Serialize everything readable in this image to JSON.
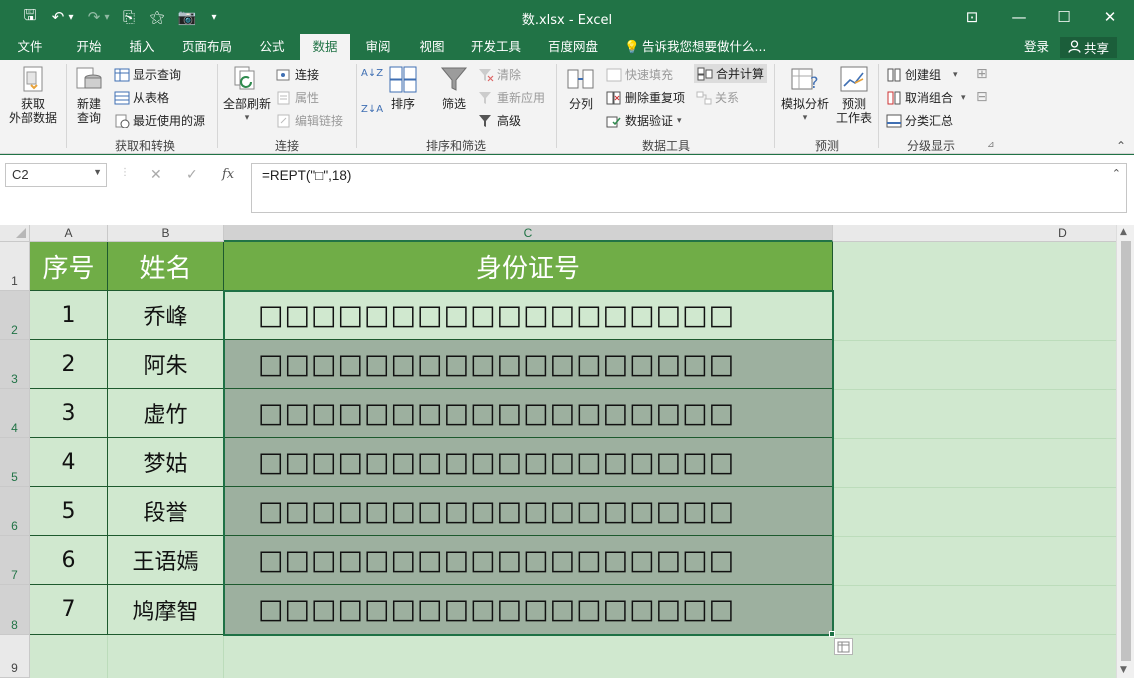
{
  "titlebar": {
    "title": "数.xlsx - Excel",
    "quick_access": {
      "save": "🖫",
      "undo": "↶",
      "undo_dd": "▾",
      "redo": "↷",
      "redo_dd": "▾",
      "q1": "⎘",
      "q2": "⚝",
      "q3": "📷",
      "customize": "▾"
    },
    "window": {
      "ribbon_opts": "⊡",
      "minimize": "—",
      "maximize": "☐",
      "close": "✕"
    }
  },
  "tabs": [
    "文件",
    "开始",
    "插入",
    "页面布局",
    "公式",
    "数据",
    "审阅",
    "视图",
    "开发工具",
    "百度网盘"
  ],
  "active_tab": "数据",
  "tellme": "告诉我您想要做什么...",
  "signin": "登录",
  "share": "共享",
  "ribbon": {
    "get_external": "获取\n外部数据",
    "new_query": "新建\n查询",
    "show_queries": "显示查询",
    "from_table": "从表格",
    "recent_sources": "最近使用的源",
    "group_get_transform": "获取和转换",
    "refresh_all": "全部刷新",
    "connections": "连接",
    "properties": "属性",
    "edit_links": "编辑链接",
    "group_connections": "连接",
    "sort_az": "A↓Z",
    "sort_za": "Z↓A",
    "sort": "排序",
    "filter": "筛选",
    "clear": "清除",
    "reapply": "重新应用",
    "advanced": "高级",
    "group_sort_filter": "排序和筛选",
    "text_to_columns": "分列",
    "flash_fill": "快速填充",
    "remove_duplicates": "删除重复项",
    "data_validation": "数据验证",
    "consolidate": "合并计算",
    "relationships": "关系",
    "group_data_tools": "数据工具",
    "what_if": "模拟分析",
    "forecast_sheet": "预测\n工作表",
    "group_forecast": "预测",
    "group": "创建组",
    "ungroup": "取消组合",
    "subtotal": "分类汇总",
    "group_outline": "分级显示",
    "collapse": "⌃",
    "dropdown": "▾"
  },
  "formula_bar": {
    "name_box": "C2",
    "cancel": "✕",
    "enter": "✓",
    "fx": "fx",
    "formula": "=REPT(\"□\",18)"
  },
  "columns": [
    "A",
    "B",
    "C",
    "D"
  ],
  "rows": [
    "1",
    "2",
    "3",
    "4",
    "5",
    "6",
    "7",
    "8",
    "9"
  ],
  "table": {
    "headers": [
      "序号",
      "姓名",
      "身份证号"
    ],
    "rows": [
      {
        "no": "1",
        "name": "乔峰",
        "id": "□□□□□□□□□□□□□□□□□□"
      },
      {
        "no": "2",
        "name": "阿朱",
        "id": "□□□□□□□□□□□□□□□□□□"
      },
      {
        "no": "3",
        "name": "虚竹",
        "id": "□□□□□□□□□□□□□□□□□□"
      },
      {
        "no": "4",
        "name": "梦姑",
        "id": "□□□□□□□□□□□□□□□□□□"
      },
      {
        "no": "5",
        "name": "段誉",
        "id": "□□□□□□□□□□□□□□□□□□"
      },
      {
        "no": "6",
        "name": "王语嫣",
        "id": "□□□□□□□□□□□□□□□□□□"
      },
      {
        "no": "7",
        "name": "鸠摩智",
        "id": "□□□□□□□□□□□□□□□□□□"
      }
    ]
  },
  "colors": {
    "excel_green": "#217346",
    "header_fill": "#70ad47",
    "body_fill": "#d0e8cf",
    "selection_fill": "#9db09f"
  },
  "icons": {
    "paste_options": "paste-options-icon",
    "tellme": "lightbulb-icon",
    "share": "person-icon"
  }
}
